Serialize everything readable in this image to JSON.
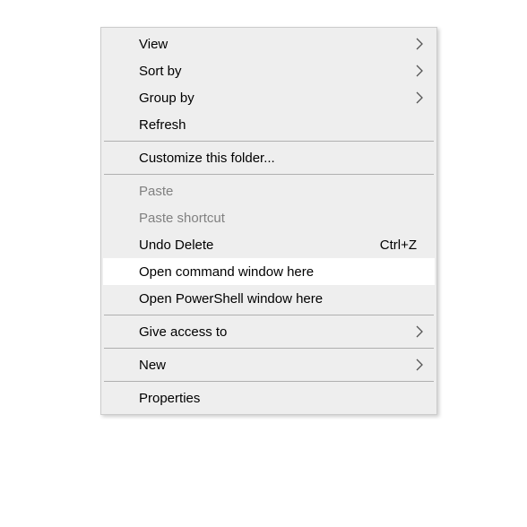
{
  "menu": {
    "view": "View",
    "sortby": "Sort by",
    "groupby": "Group by",
    "refresh": "Refresh",
    "customize": "Customize this folder...",
    "paste": "Paste",
    "paste_shortcut": "Paste shortcut",
    "undo_delete": "Undo Delete",
    "undo_delete_shortcut": "Ctrl+Z",
    "open_cmd": "Open command window here",
    "open_powershell": "Open PowerShell window here",
    "give_access": "Give access to",
    "new": "New",
    "properties": "Properties"
  }
}
